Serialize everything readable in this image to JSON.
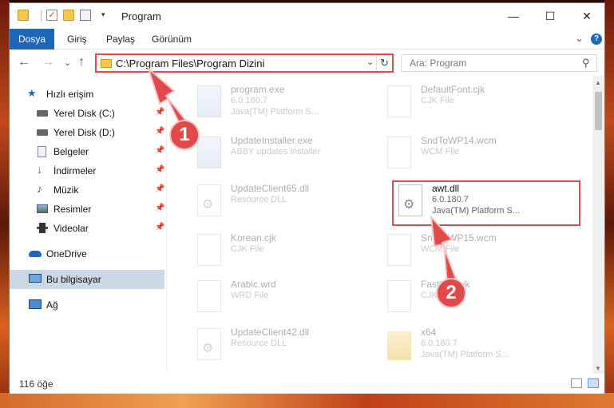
{
  "window": {
    "title": "Program",
    "minimize": "—",
    "maximize": "☐",
    "close": "✕"
  },
  "ribbon": {
    "tabs": [
      "Dosya",
      "Giriş",
      "Paylaş",
      "Görünüm"
    ],
    "collapse": "⌄",
    "help": "?"
  },
  "nav": {
    "back": "←",
    "forward": "→",
    "recent": "⌄",
    "up": "↑",
    "address": "C:\\Program Files\\Program Dizini",
    "refresh": "↻",
    "address_dropdown": "⌄",
    "search_placeholder": "Ara: Program"
  },
  "sidebar": {
    "items": [
      {
        "label": "Hızlı erişim",
        "icon": "star-icon"
      },
      {
        "label": "Yerel Disk (C:)",
        "icon": "drive-icon"
      },
      {
        "label": "Yerel Disk (D:)",
        "icon": "drive-icon"
      },
      {
        "label": "Belgeler",
        "icon": "documents-icon"
      },
      {
        "label": "İndirmeler",
        "icon": "download-icon"
      },
      {
        "label": "Müzik",
        "icon": "music-icon"
      },
      {
        "label": "Resimler",
        "icon": "pictures-icon"
      },
      {
        "label": "Videolar",
        "icon": "video-icon"
      },
      {
        "label": "OneDrive",
        "icon": "cloud-icon"
      },
      {
        "label": "Bu bilgisayar",
        "icon": "computer-icon"
      },
      {
        "label": "Ağ",
        "icon": "network-icon"
      }
    ]
  },
  "files": [
    {
      "name": "program.exe",
      "meta": "6.0.180.7",
      "meta2": "Java(TM) Platform S...",
      "type": "exe",
      "faded": true
    },
    {
      "name": "DefaultFont.cjk",
      "meta": "CJK File",
      "meta2": "",
      "type": "doc",
      "faded": true
    },
    {
      "name": "UpdateInstaller.exe",
      "meta": "ABBY updates installer",
      "meta2": "",
      "type": "exe",
      "faded": true
    },
    {
      "name": "SndToWP14.wcm",
      "meta": "WCM File",
      "meta2": "",
      "type": "doc",
      "faded": true
    },
    {
      "name": "UpdateClient65.dll",
      "meta": "Resource DLL",
      "meta2": "",
      "type": "dll",
      "faded": true
    },
    {
      "name": "awt.dll",
      "meta": "6.0.180.7",
      "meta2": "Java(TM) Platform S...",
      "type": "dll",
      "faded": false
    },
    {
      "name": "Korean.cjk",
      "meta": "CJK File",
      "meta2": "",
      "type": "doc",
      "faded": true
    },
    {
      "name": "SndToWP15.wcm",
      "meta": "WCM File",
      "meta2": "",
      "type": "doc",
      "faded": true
    },
    {
      "name": "Arabic.wrd",
      "meta": "WRD File",
      "meta2": "",
      "type": "doc",
      "faded": true
    },
    {
      "name": "FastLog.cjk",
      "meta": "CJK File",
      "meta2": "",
      "type": "doc",
      "faded": true
    },
    {
      "name": "UpdateClient42.dll",
      "meta": "Resource DLL",
      "meta2": "",
      "type": "dll",
      "faded": true
    },
    {
      "name": "x64",
      "meta": "6.0.180.7",
      "meta2": "Java(TM) Platform S...",
      "type": "folder",
      "faded": true
    }
  ],
  "status": {
    "count": "116 öğe"
  },
  "annotations": {
    "marker1": "1",
    "marker2": "2",
    "color": "#e14a4a"
  }
}
